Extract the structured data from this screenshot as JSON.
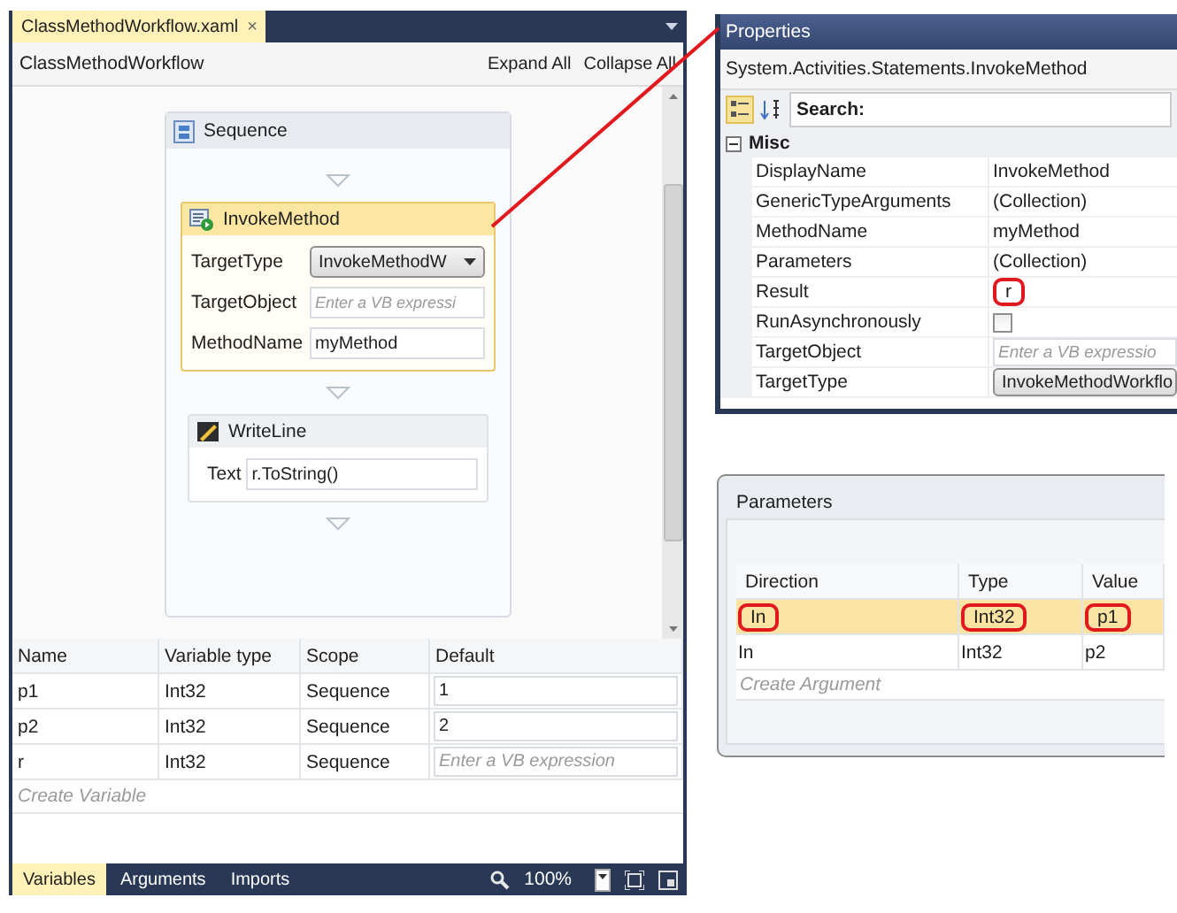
{
  "editor": {
    "tab": {
      "label": "ClassMethodWorkflow.xaml",
      "close": "×",
      "selected": true
    },
    "breadcrumb": "ClassMethodWorkflow",
    "actions": [
      "Expand All",
      "Collapse All"
    ],
    "sequence": {
      "title": "Sequence",
      "activities": [
        {
          "kind": "invoke",
          "title": "InvokeMethod",
          "selected": true,
          "fields": [
            {
              "label": "TargetType",
              "kind": "dropdown",
              "value": "InvokeMethodW"
            },
            {
              "label": "TargetObject",
              "kind": "text",
              "placeholder": "Enter a VB expressi"
            },
            {
              "label": "MethodName",
              "kind": "text",
              "value": "myMethod"
            }
          ]
        },
        {
          "kind": "writeline",
          "title": "WriteLine",
          "selected": false,
          "fields": [
            {
              "label": "Text",
              "kind": "text",
              "value": "r.ToString()"
            }
          ]
        }
      ]
    },
    "variables": {
      "columns": [
        "Name",
        "Variable type",
        "Scope",
        "Default"
      ],
      "rows": [
        {
          "name": "p1",
          "type": "Int32",
          "scope": "Sequence",
          "default": {
            "value": "1"
          }
        },
        {
          "name": "p2",
          "type": "Int32",
          "scope": "Sequence",
          "default": {
            "value": "2"
          }
        },
        {
          "name": "r",
          "type": "Int32",
          "scope": "Sequence",
          "default": {
            "placeholder": "Enter a VB expression"
          }
        }
      ],
      "create": "Create Variable"
    },
    "bottom_tabs": [
      {
        "label": "Variables",
        "selected": true
      },
      {
        "label": "Arguments",
        "selected": false
      },
      {
        "label": "Imports",
        "selected": false
      }
    ],
    "zoom": "100%"
  },
  "properties": {
    "title": "Properties",
    "type_name": "System.Activities.Statements.InvokeMethod",
    "search_label": "Search:",
    "category": {
      "name": "Misc",
      "expanded": true
    },
    "items": [
      {
        "name": "DisplayName",
        "kind": "text",
        "value": "InvokeMethod"
      },
      {
        "name": "GenericTypeArguments",
        "kind": "text",
        "value": "(Collection)"
      },
      {
        "name": "MethodName",
        "kind": "text",
        "value": "myMethod"
      },
      {
        "name": "Parameters",
        "kind": "text",
        "value": "(Collection)"
      },
      {
        "name": "Result",
        "kind": "text",
        "value": "r",
        "circled": true
      },
      {
        "name": "RunAsynchronously",
        "kind": "checkbox",
        "checked": false
      },
      {
        "name": "TargetObject",
        "kind": "text",
        "placeholder": "Enter a VB expressio"
      },
      {
        "name": "TargetType",
        "kind": "dropdown",
        "value": "InvokeMethodWorkflo"
      }
    ]
  },
  "parameters": {
    "title": "Parameters",
    "columns": [
      "Direction",
      "Type",
      "Value"
    ],
    "rows": [
      {
        "direction": "In",
        "type": "Int32",
        "value": "p1",
        "selected": true,
        "circled": true
      },
      {
        "direction": "In",
        "type": "Int32",
        "value": "p2",
        "selected": false,
        "circled": false
      }
    ],
    "create": "Create Argument"
  }
}
